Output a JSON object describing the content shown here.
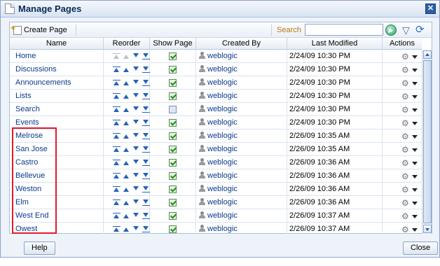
{
  "dialog": {
    "title": "Manage Pages"
  },
  "toolbar": {
    "create_label": "Create Page",
    "search_label": "Search",
    "search_value": "",
    "search_placeholder": ""
  },
  "columns": {
    "name": "Name",
    "reorder": "Reorder",
    "show": "Show Page",
    "created": "Created By",
    "modified": "Last Modified",
    "actions": "Actions"
  },
  "pages": [
    {
      "name": "Home",
      "show": true,
      "created_by": "weblogic",
      "modified": "2/24/09 10:30 PM",
      "first": true
    },
    {
      "name": "Discussions",
      "show": true,
      "created_by": "weblogic",
      "modified": "2/24/09 10:30 PM",
      "first": false
    },
    {
      "name": "Announcements",
      "show": true,
      "created_by": "weblogic",
      "modified": "2/24/09 10:30 PM",
      "first": false
    },
    {
      "name": "Lists",
      "show": true,
      "created_by": "weblogic",
      "modified": "2/24/09 10:30 PM",
      "first": false
    },
    {
      "name": "Search",
      "show": false,
      "created_by": "weblogic",
      "modified": "2/24/09 10:30 PM",
      "first": false
    },
    {
      "name": "Events",
      "show": true,
      "created_by": "weblogic",
      "modified": "2/24/09 10:30 PM",
      "first": false
    },
    {
      "name": "Melrose",
      "show": true,
      "created_by": "weblogic",
      "modified": "2/26/09 10:35 AM",
      "first": false
    },
    {
      "name": "San Jose",
      "show": true,
      "created_by": "weblogic",
      "modified": "2/26/09 10:35 AM",
      "first": false
    },
    {
      "name": "Castro",
      "show": true,
      "created_by": "weblogic",
      "modified": "2/26/09 10:36 AM",
      "first": false
    },
    {
      "name": "Bellevue",
      "show": true,
      "created_by": "weblogic",
      "modified": "2/26/09 10:36 AM",
      "first": false
    },
    {
      "name": "Weston",
      "show": true,
      "created_by": "weblogic",
      "modified": "2/26/09 10:36 AM",
      "first": false
    },
    {
      "name": "Elm",
      "show": true,
      "created_by": "weblogic",
      "modified": "2/26/09 10:36 AM",
      "first": false
    },
    {
      "name": "West End",
      "show": true,
      "created_by": "weblogic",
      "modified": "2/26/09 10:37 AM",
      "first": false
    },
    {
      "name": "Owest",
      "show": true,
      "created_by": "weblogic",
      "modified": "2/26/09 10:37 AM",
      "first": false
    }
  ],
  "footer": {
    "help_label": "Help",
    "close_label": "Close"
  },
  "icons": {
    "title": "page-icon",
    "close": "close-icon",
    "create": "create-page-icon",
    "go": "go-icon",
    "filter": "filter-icon",
    "refresh": "refresh-icon",
    "user": "user-icon",
    "gear": "gear-icon"
  },
  "colors": {
    "link": "#0b3a8c",
    "highlight": "#e21b2a",
    "search_label": "#b9780c"
  }
}
